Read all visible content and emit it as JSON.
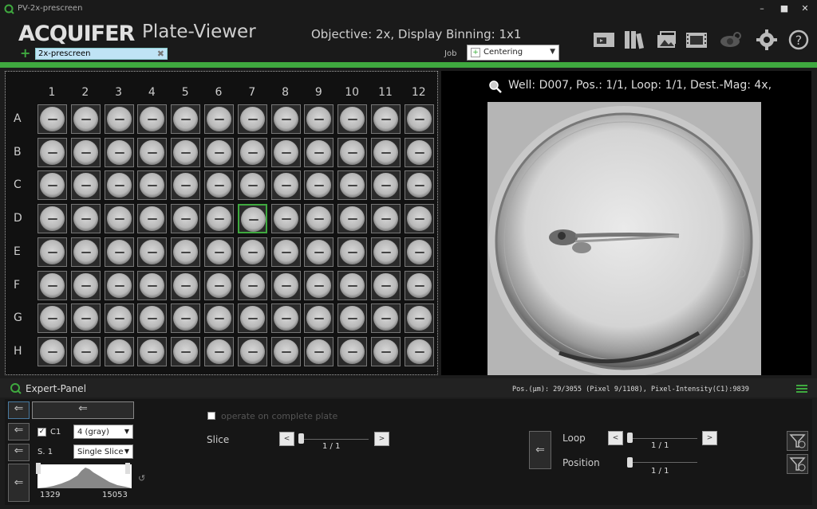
{
  "window": {
    "title": "PV-2x-prescreen"
  },
  "header": {
    "logo": "ACQUIFER",
    "app_title": "Plate-Viewer",
    "objective": "Objective: 2x, Display Binning: 1x1",
    "search_value": "2x-prescreen",
    "job_label": "Job",
    "job_value": "Centering"
  },
  "plate": {
    "columns": [
      "1",
      "2",
      "3",
      "4",
      "5",
      "6",
      "7",
      "8",
      "9",
      "10",
      "11",
      "12"
    ],
    "rows": [
      "A",
      "B",
      "C",
      "D",
      "E",
      "F",
      "G",
      "H"
    ],
    "selected_well": "D007"
  },
  "viewer": {
    "info": "Well: D007, Pos.: 1/1, Loop: 1/1, Dest.-Mag: 4x,"
  },
  "expert": {
    "title": "Expert-Panel",
    "pos_info": "Pos.(µm): 29/3055 (Pixel 9/1108), Pixel-Intensity(C1):9839",
    "channel_label": "C1",
    "channel_color": "4 (gray)",
    "slice_mode_label": "S. 1",
    "slice_mode": "Single Slice",
    "hist_min": "1329",
    "hist_max": "15053",
    "operate_label": "operate on complete plate",
    "slice_label": "Slice",
    "slice_value": "1 / 1",
    "loop_label": "Loop",
    "loop_value": "1 / 1",
    "position_label": "Position",
    "position_value": "1 / 1"
  },
  "colors": {
    "accent": "#3fa93f",
    "background": "#1c1c1c"
  }
}
